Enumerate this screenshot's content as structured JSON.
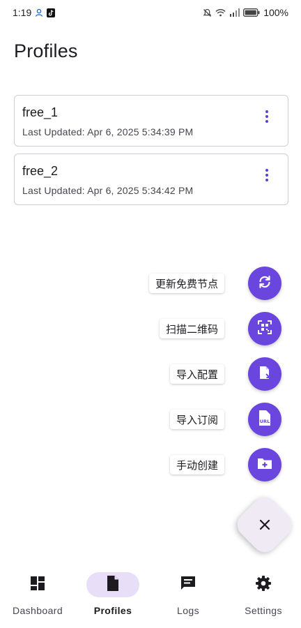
{
  "status_bar": {
    "time": "1:19",
    "battery": "100%"
  },
  "page": {
    "title": "Profiles"
  },
  "profiles": [
    {
      "name": "free_1",
      "updated": "Last Updated: Apr 6, 2025 5:34:39 PM"
    },
    {
      "name": "free_2",
      "updated": "Last Updated: Apr 6, 2025 5:34:42 PM"
    }
  ],
  "fab_menu": {
    "items": [
      {
        "label": "更新免费节点",
        "icon": "refresh-icon"
      },
      {
        "label": "扫描二维码",
        "icon": "qr-scan-icon"
      },
      {
        "label": "导入配置",
        "icon": "file-import-icon"
      },
      {
        "label": "导入订阅",
        "icon": "url-file-icon"
      },
      {
        "label": "手动创建",
        "icon": "folder-add-icon"
      }
    ],
    "close_icon": "close-icon"
  },
  "bottom_nav": {
    "items": [
      {
        "label": "Dashboard",
        "icon": "dashboard-icon"
      },
      {
        "label": "Profiles",
        "icon": "document-icon",
        "active": true
      },
      {
        "label": "Logs",
        "icon": "chat-icon"
      },
      {
        "label": "Settings",
        "icon": "gear-icon"
      }
    ]
  },
  "colors": {
    "accent": "#6a46df",
    "active_pill": "#e8def8",
    "menu_dots": "#5b3fd0"
  }
}
